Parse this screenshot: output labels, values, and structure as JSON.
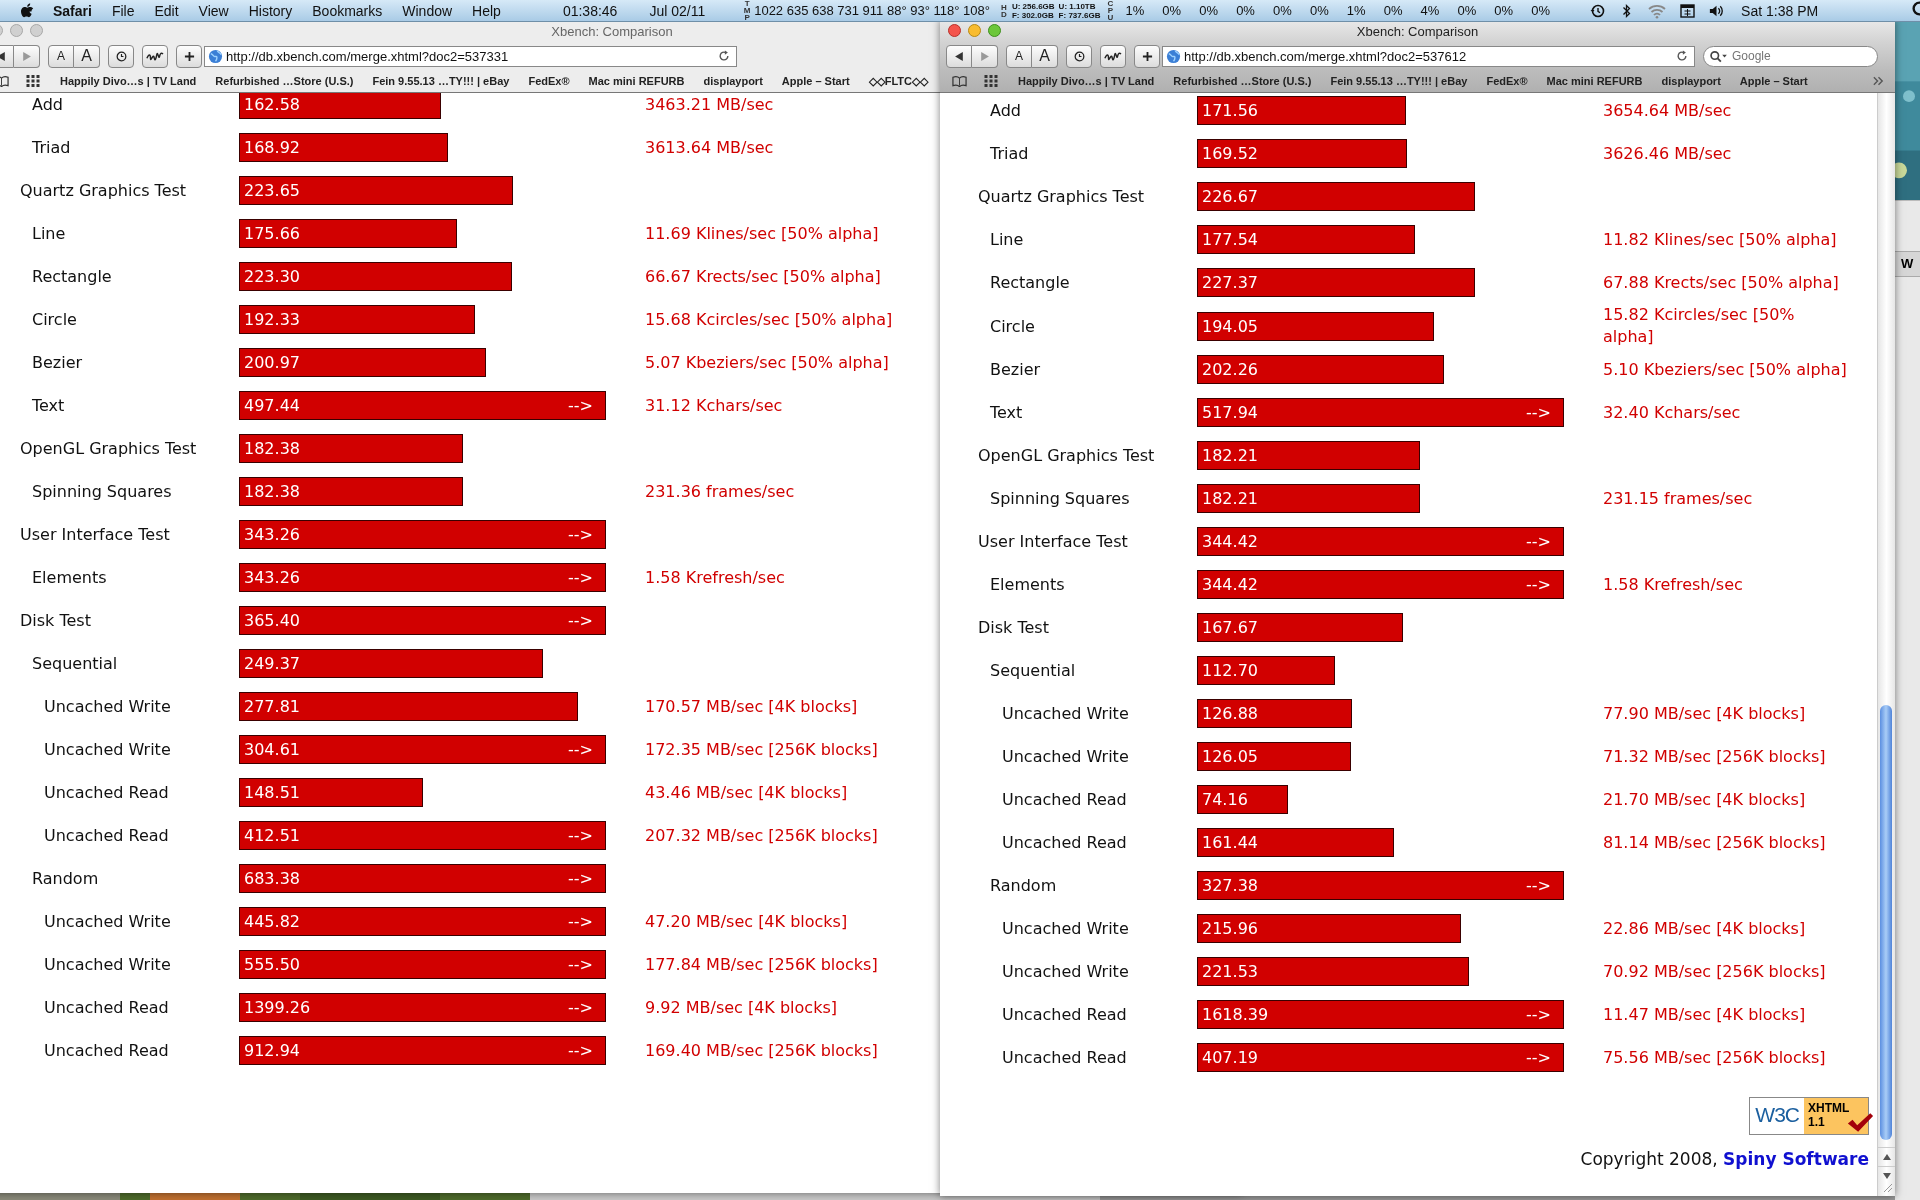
{
  "menu_bar": {
    "app": "Safari",
    "menus": [
      "File",
      "Edit",
      "View",
      "History",
      "Bookmarks",
      "Window",
      "Help"
    ],
    "clock": "01:38:46",
    "date": "Jul 02/11",
    "temp_label": "TMP",
    "temps": "1022 635 638 731 911 88° 93° 118° 108°",
    "disk_label": "HD",
    "disks": [
      {
        "used": "U: 256.6GB",
        "free": "F: 302.0GB"
      },
      {
        "used": "U: 1.10TB",
        "free": "F: 737.6GB"
      }
    ],
    "cpu_label": "CPU",
    "cpu": [
      "1%",
      "0%",
      "0%",
      "0%",
      "0%",
      "0%",
      "1%",
      "0%",
      "4%",
      "0%",
      "0%",
      "0%"
    ],
    "time": "Sat 1:38 PM"
  },
  "windows": [
    {
      "active": false,
      "title": "Xbench: Comparison",
      "text_size": [
        "A",
        "A"
      ],
      "url": "http://db.xbench.com/merge.xhtml?doc2=537331",
      "bookmarks": [
        "Happily Divo…s | TV Land",
        "Refurbished …Store (U.S.)",
        "Fein 9.55.13 …TY!!! | eBay",
        "FedEx®",
        "Mac mini REFURB",
        "displayport",
        "Apple – Start",
        "◇◇FLTC◇◇"
      ],
      "results": [
        {
          "children": [
            {
              "name": "Add",
              "score": "162.58",
              "level": 0.55,
              "rate": "3463.21 MB/sec"
            },
            {
              "name": "Triad",
              "score": "168.92",
              "level": 0.57,
              "rate": "3613.64 MB/sec"
            }
          ]
        },
        {
          "name": "Quartz Graphics Test",
          "score": "223.65",
          "level": 0.747,
          "children": [
            {
              "name": "Line",
              "score": "175.66",
              "level": 0.593,
              "rate": "11.69 Klines/sec [50% alpha]"
            },
            {
              "name": "Rectangle",
              "score": "223.30",
              "level": 0.743,
              "rate": "66.67 Krects/sec [50% alpha]"
            },
            {
              "name": "Circle",
              "score": "192.33",
              "level": 0.643,
              "rate": "15.68 Kcircles/sec [50% alpha]"
            },
            {
              "name": "Bezier",
              "score": "200.97",
              "level": 0.673,
              "rate": "5.07 Kbeziers/sec [50% alpha]"
            },
            {
              "name": "Text",
              "score": "497.44",
              "level": 1,
              "arrow": "-->",
              "rate": "31.12 Kchars/sec"
            }
          ]
        },
        {
          "name": "OpenGL Graphics Test",
          "score": "182.38",
          "level": 0.61,
          "children": [
            {
              "name": "Spinning Squares",
              "score": "182.38",
              "level": 0.61,
              "rate": "231.36 frames/sec"
            }
          ]
        },
        {
          "name": "User Interface Test",
          "score": "343.26",
          "level": 1,
          "arrow": "-->",
          "children": [
            {
              "name": "Elements",
              "score": "343.26",
              "level": 1,
              "arrow": "-->",
              "rate": "1.58 Krefresh/sec"
            }
          ]
        },
        {
          "name": "Disk Test",
          "score": "365.40",
          "level": 1,
          "arrow": "-->",
          "children": [
            {
              "name": "Sequential",
              "score": "249.37",
              "level": 0.827,
              "children": [
                {
                  "name": "Uncached Write",
                  "score": "277.81",
                  "level": 0.923,
                  "rate": "170.57 MB/sec [4K blocks]"
                },
                {
                  "name": "Uncached Write",
                  "score": "304.61",
                  "level": 1,
                  "arrow": "-->",
                  "rate": "172.35 MB/sec [256K blocks]"
                },
                {
                  "name": "Uncached Read",
                  "score": "148.51",
                  "level": 0.5,
                  "rate": "43.46 MB/sec [4K blocks]"
                },
                {
                  "name": "Uncached Read",
                  "score": "412.51",
                  "level": 1,
                  "arrow": "-->",
                  "rate": "207.32 MB/sec [256K blocks]"
                }
              ]
            },
            {
              "name": "Random",
              "score": "683.38",
              "level": 1,
              "arrow": "-->",
              "children": [
                {
                  "name": "Uncached Write",
                  "score": "445.82",
                  "level": 1,
                  "arrow": "-->",
                  "rate": "47.20 MB/sec [4K blocks]"
                },
                {
                  "name": "Uncached Write",
                  "score": "555.50",
                  "level": 1,
                  "arrow": "-->",
                  "rate": "177.84 MB/sec [256K blocks]"
                },
                {
                  "name": "Uncached Read",
                  "score": "1399.26",
                  "level": 1,
                  "arrow": "-->",
                  "rate": "9.92 MB/sec [4K blocks]"
                },
                {
                  "name": "Uncached Read",
                  "score": "912.94",
                  "level": 1,
                  "arrow": "-->",
                  "rate": "169.40 MB/sec [256K blocks]"
                }
              ]
            }
          ]
        }
      ]
    },
    {
      "active": true,
      "title": "Xbench: Comparison",
      "text_size": [
        "A",
        "A"
      ],
      "url": "http://db.xbench.com/merge.xhtml?doc2=537612",
      "search": {
        "placeholder": "Google"
      },
      "bookmarks": [
        "Happily Divo…s | TV Land",
        "Refurbished …Store (U.S.)",
        "Fein 9.55.13 …TY!!! | eBay",
        "FedEx®",
        "Mac mini REFURB",
        "displayport",
        "Apple – Start"
      ],
      "results": [
        {
          "children": [
            {
              "name": "Add",
              "score": "171.56",
              "level": 0.57,
              "rate": "3654.64 MB/sec"
            },
            {
              "name": "Triad",
              "score": "169.52",
              "level": 0.573,
              "rate": "3626.46 MB/sec"
            }
          ]
        },
        {
          "name": "Quartz Graphics Test",
          "score": "226.67",
          "level": 0.757,
          "children": [
            {
              "name": "Line",
              "score": "177.54",
              "level": 0.593,
              "rate": "11.82 Klines/sec [50% alpha]"
            },
            {
              "name": "Rectangle",
              "score": "227.37",
              "level": 0.757,
              "rate": "67.88 Krects/sec [50% alpha]"
            },
            {
              "name": "Circle",
              "score": "194.05",
              "level": 0.647,
              "rate": "15.82 Kcircles/sec [50% alpha]"
            },
            {
              "name": "Bezier",
              "score": "202.26",
              "level": 0.673,
              "rate": "5.10 Kbeziers/sec [50% alpha]"
            },
            {
              "name": "Text",
              "score": "517.94",
              "level": 1,
              "arrow": "-->",
              "rate": "32.40 Kchars/sec"
            }
          ]
        },
        {
          "name": "OpenGL Graphics Test",
          "score": "182.21",
          "level": 0.607,
          "children": [
            {
              "name": "Spinning Squares",
              "score": "182.21",
              "level": 0.607,
              "rate": "231.15 frames/sec"
            }
          ]
        },
        {
          "name": "User Interface Test",
          "score": "344.42",
          "level": 1,
          "arrow": "-->",
          "children": [
            {
              "name": "Elements",
              "score": "344.42",
              "level": 1,
              "arrow": "-->",
              "rate": "1.58 Krefresh/sec"
            }
          ]
        },
        {
          "name": "Disk Test",
          "score": "167.67",
          "level": 0.56,
          "children": [
            {
              "name": "Sequential",
              "score": "112.70",
              "level": 0.376,
              "children": [
                {
                  "name": "Uncached Write",
                  "score": "126.88",
                  "level": 0.423,
                  "rate": "77.90 MB/sec [4K blocks]"
                },
                {
                  "name": "Uncached Write",
                  "score": "126.05",
                  "level": 0.42,
                  "rate": "71.32 MB/sec [256K blocks]"
                },
                {
                  "name": "Uncached Read",
                  "score": "74.16",
                  "level": 0.247,
                  "rate": "21.70 MB/sec [4K blocks]"
                },
                {
                  "name": "Uncached Read",
                  "score": "161.44",
                  "level": 0.537,
                  "rate": "81.14 MB/sec [256K blocks]"
                }
              ]
            },
            {
              "name": "Random",
              "score": "327.38",
              "level": 1,
              "arrow": "-->",
              "children": [
                {
                  "name": "Uncached Write",
                  "score": "215.96",
                  "level": 0.72,
                  "rate": "22.86 MB/sec [4K blocks]"
                },
                {
                  "name": "Uncached Write",
                  "score": "221.53",
                  "level": 0.74,
                  "rate": "70.92 MB/sec [256K blocks]"
                },
                {
                  "name": "Uncached Read",
                  "score": "1618.39",
                  "level": 1,
                  "arrow": "-->",
                  "rate": "11.47 MB/sec [4K blocks]"
                },
                {
                  "name": "Uncached Read",
                  "score": "407.19",
                  "level": 1,
                  "arrow": "-->",
                  "rate": "75.56 MB/sec [256K blocks]"
                }
              ]
            }
          ]
        }
      ],
      "footer": {
        "badge": {
          "logo": "W3C",
          "label": "XHTML",
          "version": "1.1"
        },
        "text": "Copyright 2008,",
        "link": "Spiny Software"
      }
    }
  ],
  "background_window": {
    "button": "W"
  }
}
